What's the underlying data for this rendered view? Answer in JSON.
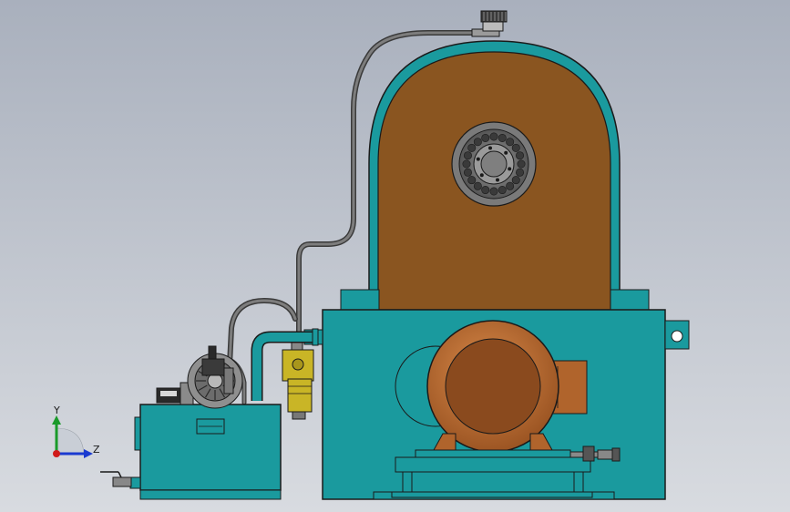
{
  "viewport": {
    "background_top": "#a9b0bd",
    "background_bottom": "#d8dbe0"
  },
  "colors": {
    "teal": "#1a9a9e",
    "teal_dark": "#0e6f73",
    "bronze": "#8a5520",
    "motor": "#b0642c",
    "motor_light": "#c97b3c",
    "yellow": "#c9b526",
    "hose": "#6f6f6f",
    "outline": "#1a1a1a"
  },
  "triad": {
    "y_label": "Y",
    "z_label": "Z",
    "y_color": "#1a9a2a",
    "z_color": "#1a3ad0",
    "origin_color": "#d01a1a"
  }
}
